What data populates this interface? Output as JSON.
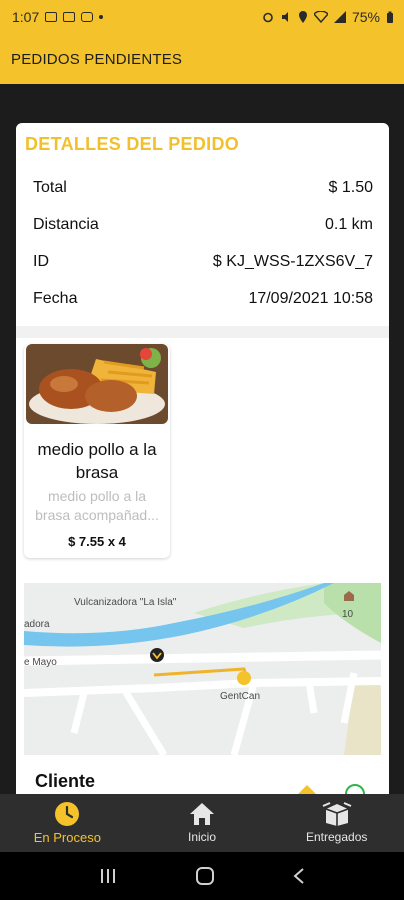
{
  "status_bar": {
    "time": "1:07",
    "battery": "75%"
  },
  "app_bar": {
    "title": "PEDIDOS PENDIENTES"
  },
  "order": {
    "section_title": "DETALLES DEL PEDIDO",
    "rows": [
      {
        "label": "Total",
        "value": "$ 1.50"
      },
      {
        "label": "Distancia",
        "value": "0.1 km"
      },
      {
        "label": "ID",
        "value": "$ KJ_WSS-1ZXS6V_7"
      },
      {
        "label": "Fecha",
        "value": "17/09/2021 10:58"
      }
    ]
  },
  "product": {
    "name": "medio pollo a la brasa",
    "description": "medio pollo a la brasa acompañad...",
    "price": "$ 7.55 x 4"
  },
  "map": {
    "labels": [
      "Vulcanizadora \"La Isla\"",
      "adora",
      "e Mayo",
      "GentCan",
      "10"
    ]
  },
  "client": {
    "label": "Cliente"
  },
  "bottom_nav": {
    "items": [
      {
        "label": "En Proceso",
        "icon": "clock-icon",
        "active": true
      },
      {
        "label": "Inicio",
        "icon": "home-icon",
        "active": false
      },
      {
        "label": "Entregados",
        "icon": "box-icon",
        "active": false
      }
    ]
  },
  "colors": {
    "accent": "#f4c22b",
    "nav_bg": "#2e2e2e",
    "page_bg": "#1c1c1c"
  }
}
